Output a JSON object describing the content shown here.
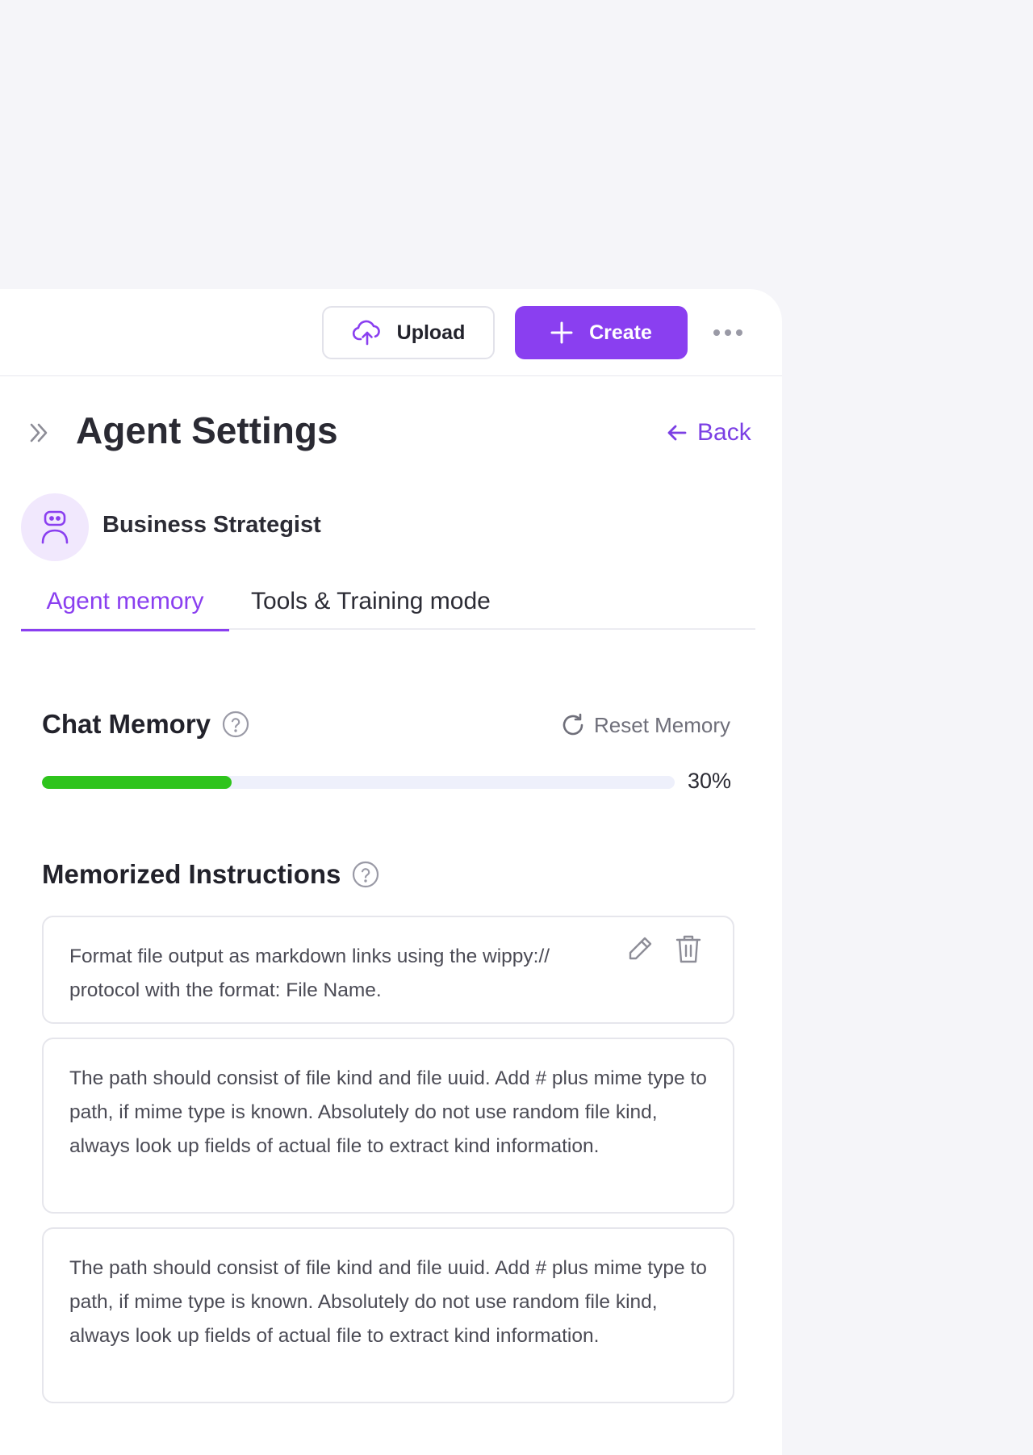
{
  "toolbar": {
    "upload_label": "Upload",
    "create_label": "Create"
  },
  "header": {
    "title": "Agent Settings",
    "back_label": "Back"
  },
  "agent": {
    "name": "Business Strategist"
  },
  "tabs": [
    {
      "label": "Agent memory",
      "active": true
    },
    {
      "label": "Tools & Training mode",
      "active": false
    }
  ],
  "chat_memory": {
    "title": "Chat Memory",
    "reset_label": "Reset Memory",
    "progress_percent": 30,
    "progress_label": "30%"
  },
  "memorized": {
    "title": "Memorized Instructions",
    "items": [
      "Format file output as markdown links using the wippy:// protocol with the format: File Name.",
      "The path should consist of file kind and file uuid. Add # plus mime type to path, if mime type is known. Absolutely do not use random file kind, always look up fields of actual file to extract kind information.",
      "The path should consist of file kind and file uuid. Add # plus mime type to path, if mime type is known. Absolutely do not use random file kind, always look up fields of actual file to extract kind information."
    ]
  },
  "colors": {
    "accent": "#8a3ff0",
    "progress": "#2ec41c",
    "page_bg": "#f5f5f9"
  }
}
